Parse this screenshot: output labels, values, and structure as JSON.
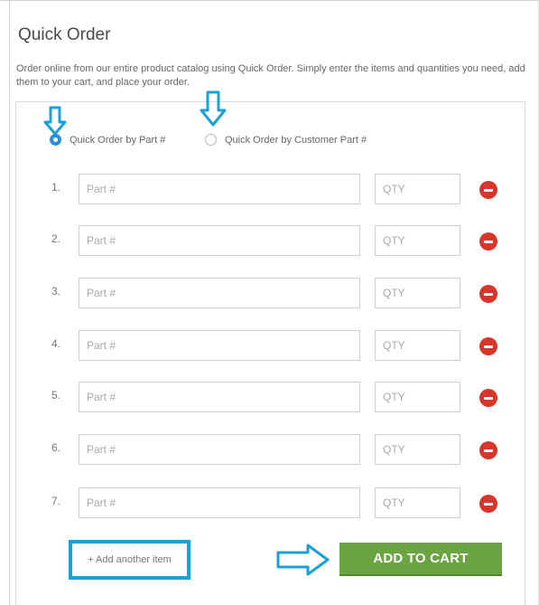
{
  "header": {
    "title": "Quick Order",
    "intro": "Order online from our entire product catalog using Quick Order. Simply enter the items and quantities you need, add them to your cart, and place your order."
  },
  "mode": {
    "options": [
      {
        "label": "Quick Order by Part #",
        "checked": true
      },
      {
        "label": "Quick Order by Customer Part #",
        "checked": false
      }
    ]
  },
  "rows": [
    {
      "num": "1.",
      "part_placeholder": "Part #",
      "qty_placeholder": "QTY"
    },
    {
      "num": "2.",
      "part_placeholder": "Part #",
      "qty_placeholder": "QTY"
    },
    {
      "num": "3.",
      "part_placeholder": "Part #",
      "qty_placeholder": "QTY"
    },
    {
      "num": "4.",
      "part_placeholder": "Part #",
      "qty_placeholder": "QTY"
    },
    {
      "num": "5.",
      "part_placeholder": "Part #",
      "qty_placeholder": "QTY"
    },
    {
      "num": "6.",
      "part_placeholder": "Part #",
      "qty_placeholder": "QTY"
    },
    {
      "num": "7.",
      "part_placeholder": "Part #",
      "qty_placeholder": "QTY"
    }
  ],
  "actions": {
    "add_item_label": "+ Add another item",
    "add_to_cart_label": "ADD TO CART"
  },
  "colors": {
    "annotation_arrow": "#1ba0d8",
    "radio_checked": "#2a8fd0",
    "remove_button": "#d9362b",
    "add_to_cart": "#6aa542"
  }
}
